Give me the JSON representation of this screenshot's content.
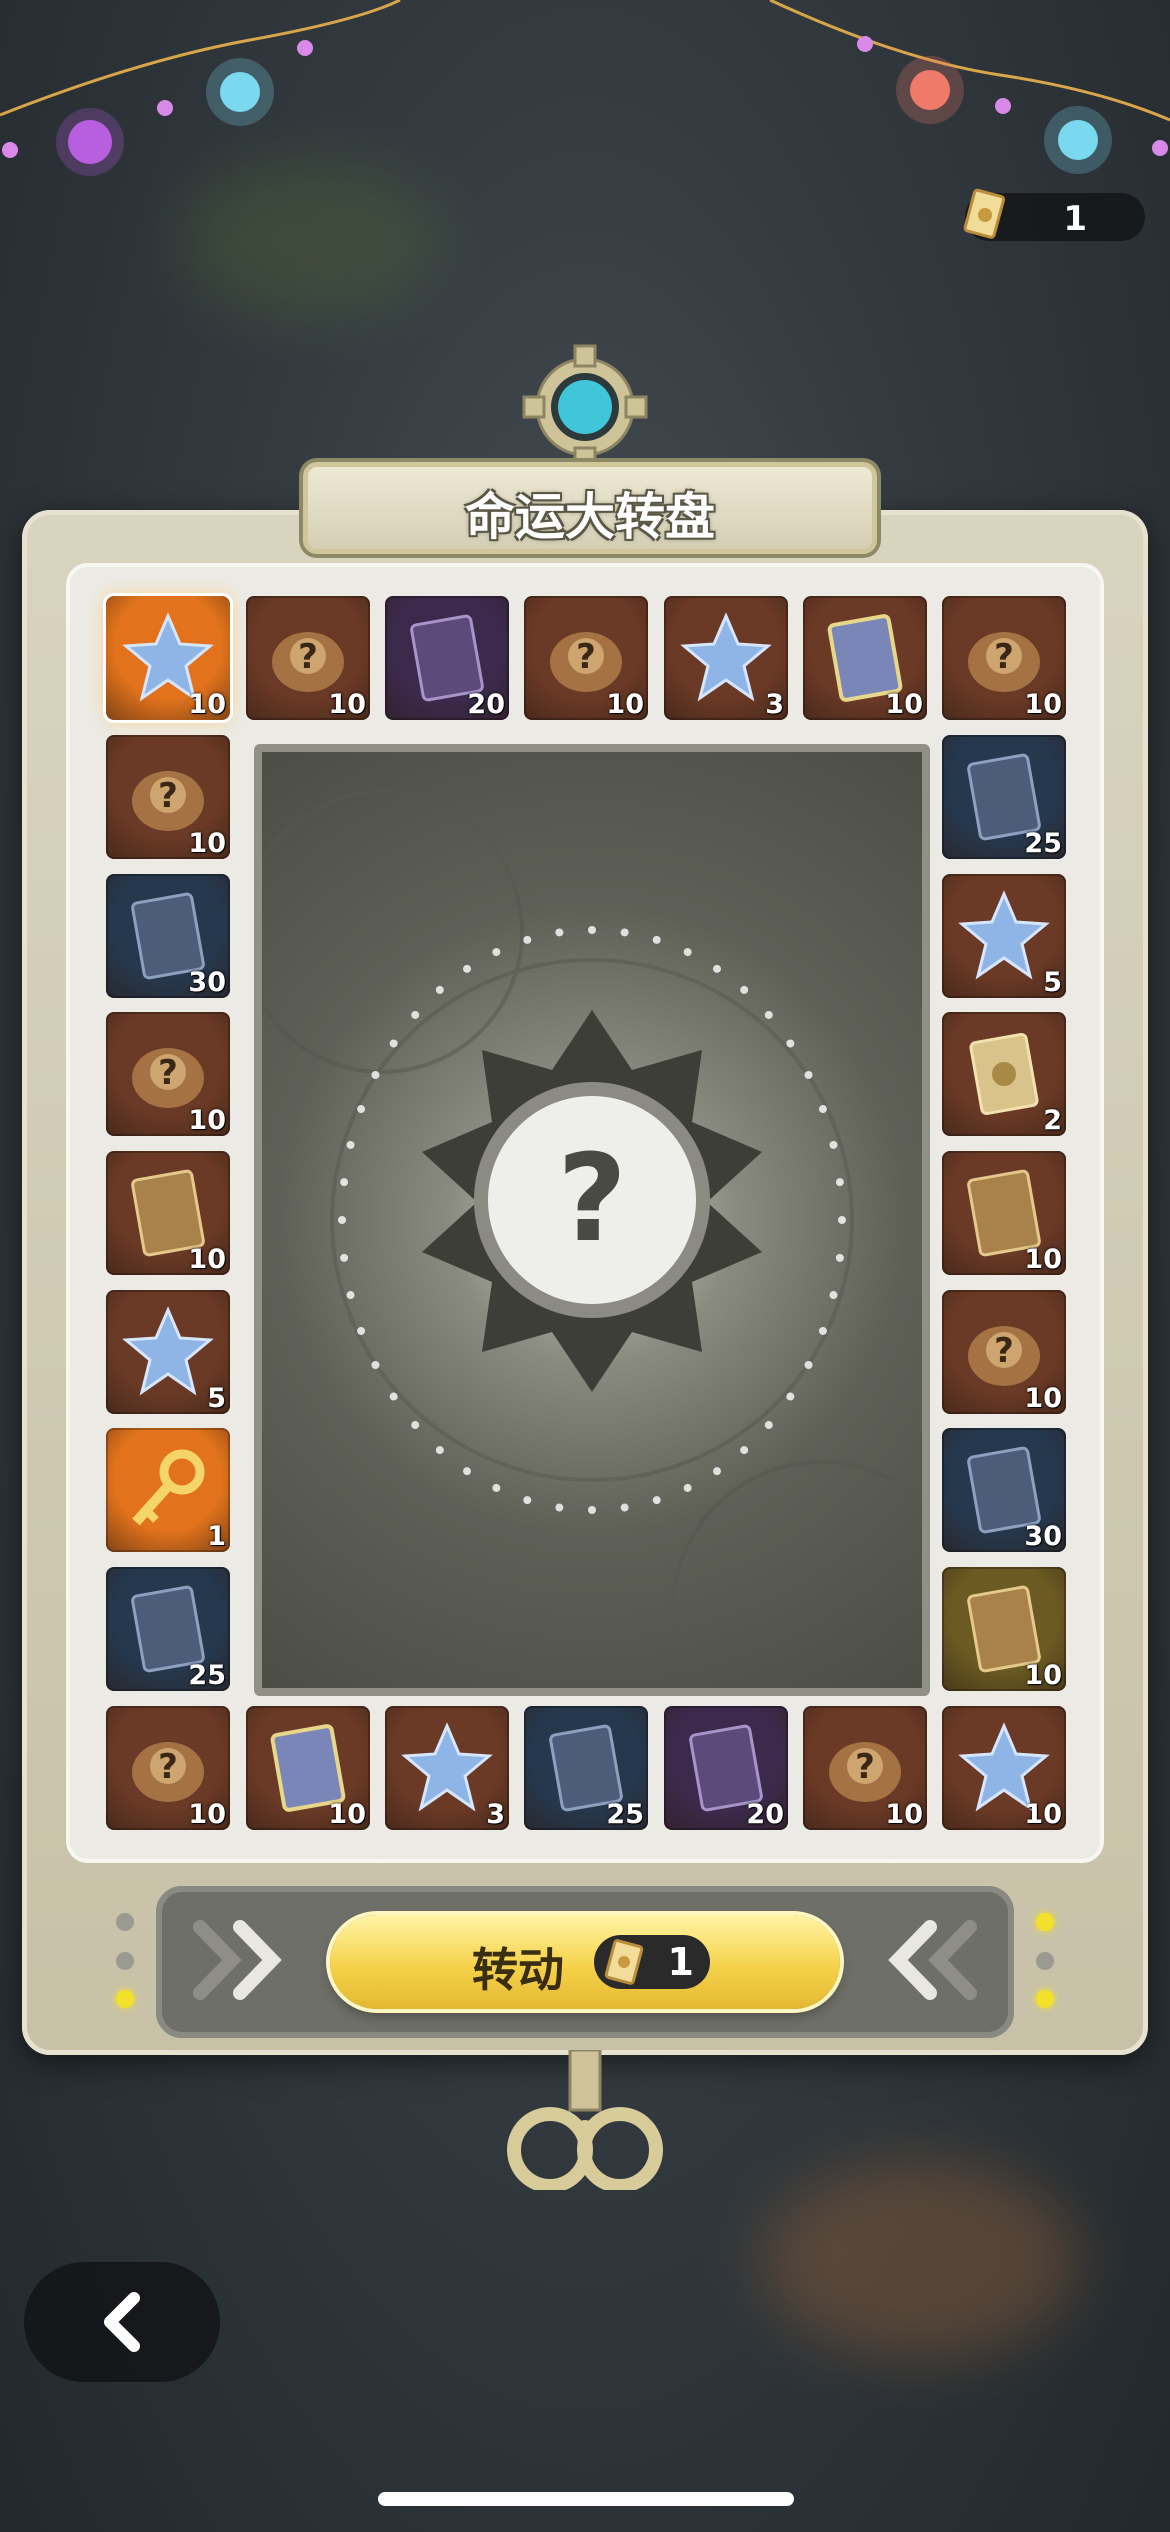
{
  "header": {
    "title": "命运大转盘"
  },
  "ticket_counter": {
    "icon": "ticket-icon",
    "value": "1"
  },
  "reward_tiles": [
    {
      "item": "crystal-star",
      "qty": "10",
      "bg": "#e2731c",
      "selected": true
    },
    {
      "item": "mystery-box",
      "qty": "10",
      "bg": "#6b3a26"
    },
    {
      "item": "portrait-card-purple",
      "qty": "20",
      "bg": "#3c2a4d"
    },
    {
      "item": "mystery-box",
      "qty": "10",
      "bg": "#6b3a26"
    },
    {
      "item": "crystal-star",
      "qty": "3",
      "bg": "#6b3a26"
    },
    {
      "item": "portrait-card-rainbow",
      "qty": "10",
      "bg": "#6b3a26"
    },
    {
      "item": "mystery-box",
      "qty": "10",
      "bg": "#6b3a26"
    },
    {
      "item": "mystery-box",
      "qty": "10",
      "bg": "#6b3a26"
    },
    {
      "item": "portrait-card-blue",
      "qty": "25",
      "bg": "#26384e"
    },
    {
      "item": "portrait-card-blue",
      "qty": "30",
      "bg": "#26384e"
    },
    {
      "item": "crystal-star",
      "qty": "5",
      "bg": "#6b3a26"
    },
    {
      "item": "mystery-box",
      "qty": "10",
      "bg": "#6b3a26"
    },
    {
      "item": "ticket-gold",
      "qty": "2",
      "bg": "#6b3a26"
    },
    {
      "item": "card-gold",
      "qty": "10",
      "bg": "#6b3a26"
    },
    {
      "item": "card-gold",
      "qty": "10",
      "bg": "#6b3a26"
    },
    {
      "item": "crystal-star",
      "qty": "5",
      "bg": "#6b3a26"
    },
    {
      "item": "mystery-box",
      "qty": "10",
      "bg": "#6b3a26"
    },
    {
      "item": "gold-key",
      "qty": "1",
      "bg": "#e2731c"
    },
    {
      "item": "portrait-card-blue",
      "qty": "30",
      "bg": "#26384e"
    },
    {
      "item": "portrait-card-blue",
      "qty": "25",
      "bg": "#26384e"
    },
    {
      "item": "card-gold",
      "qty": "10",
      "bg": "#6b5a22"
    },
    {
      "item": "mystery-box",
      "qty": "10",
      "bg": "#6b3a26"
    },
    {
      "item": "portrait-card-rainbow",
      "qty": "10",
      "bg": "#6b3a26"
    },
    {
      "item": "crystal-star",
      "qty": "3",
      "bg": "#6b3a26"
    },
    {
      "item": "portrait-card-blue",
      "qty": "25",
      "bg": "#26384e"
    },
    {
      "item": "portrait-card-purple",
      "qty": "20",
      "bg": "#3c2a4d"
    },
    {
      "item": "mystery-box",
      "qty": "10",
      "bg": "#6b3a26"
    },
    {
      "item": "crystal-star",
      "qty": "10",
      "bg": "#6b3a26"
    }
  ],
  "center": {
    "icon": "question-gear-icon",
    "symbol": "?"
  },
  "spin_button": {
    "label": "转动",
    "cost": "1",
    "cost_icon": "ticket-icon"
  },
  "decor": {
    "arrows_left": "double-chevron-right-icon",
    "arrows_right": "double-chevron-left-icon"
  },
  "back_button": {
    "icon": "chevron-left-icon"
  },
  "colors": {
    "accent_gold": "#f5d24a",
    "frame": "#d9d4bf",
    "teal_gem": "#3fc6d8"
  }
}
